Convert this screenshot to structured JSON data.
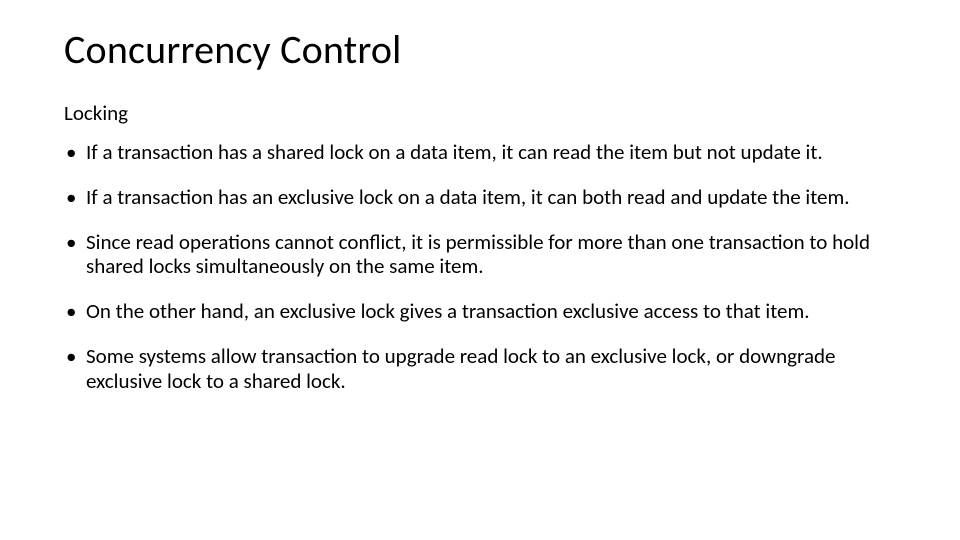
{
  "title": "Concurrency Control",
  "subtitle": "Locking",
  "bullets": [
    "If a transaction has a shared lock on a data item, it can read the item but not update it.",
    "If a transaction has an exclusive lock on a data item, it can both read and update the item.",
    "Since read operations cannot conflict, it is permissible for more than one transaction to hold shared locks simultaneously on the same item.",
    "On the other hand, an exclusive lock gives a transaction exclusive access to that item.",
    "Some systems allow transaction to upgrade read lock to an exclusive lock, or downgrade exclusive lock to a shared lock."
  ]
}
